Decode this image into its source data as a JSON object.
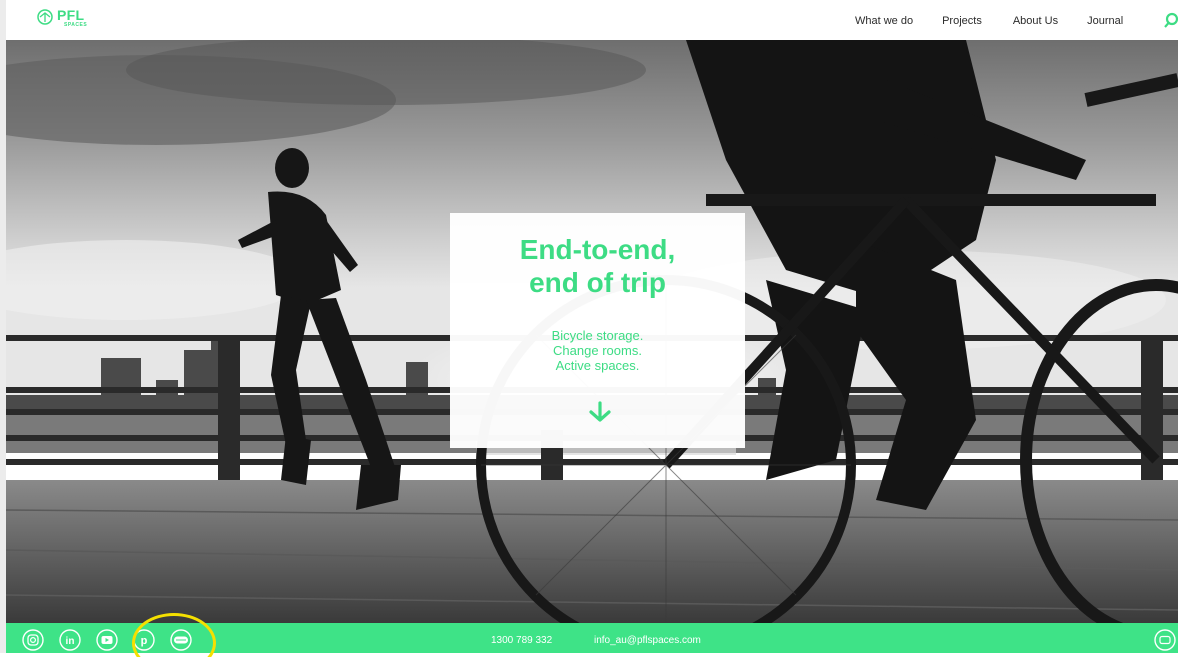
{
  "header": {
    "logo": {
      "name": "PFL",
      "sub": "SPACES",
      "icon": "pfl-logo-icon"
    },
    "nav": [
      {
        "label": "What we do"
      },
      {
        "label": "Projects"
      },
      {
        "label": "About Us"
      },
      {
        "label": "Journal"
      }
    ],
    "search_icon": "search-icon"
  },
  "hero": {
    "title_line1": "End-to-end,",
    "title_line2": "end of trip",
    "lines": [
      "Bicycle storage.",
      "Change rooms.",
      "Active spaces."
    ],
    "scroll_icon": "arrow-down-icon"
  },
  "footer": {
    "social": [
      {
        "icon": "instagram-icon"
      },
      {
        "icon": "linkedin-icon"
      },
      {
        "icon": "youtube-icon"
      },
      {
        "icon": "pinterest-icon"
      },
      {
        "icon": "bike-rack-icon"
      }
    ],
    "phone": "1300 789 332",
    "email": "info_au@pflspaces.com",
    "chat_icon": "chat-icon"
  },
  "colors": {
    "accent": "#3ddc84",
    "footer_bg": "#3ee387",
    "highlight": "#f5e000"
  }
}
